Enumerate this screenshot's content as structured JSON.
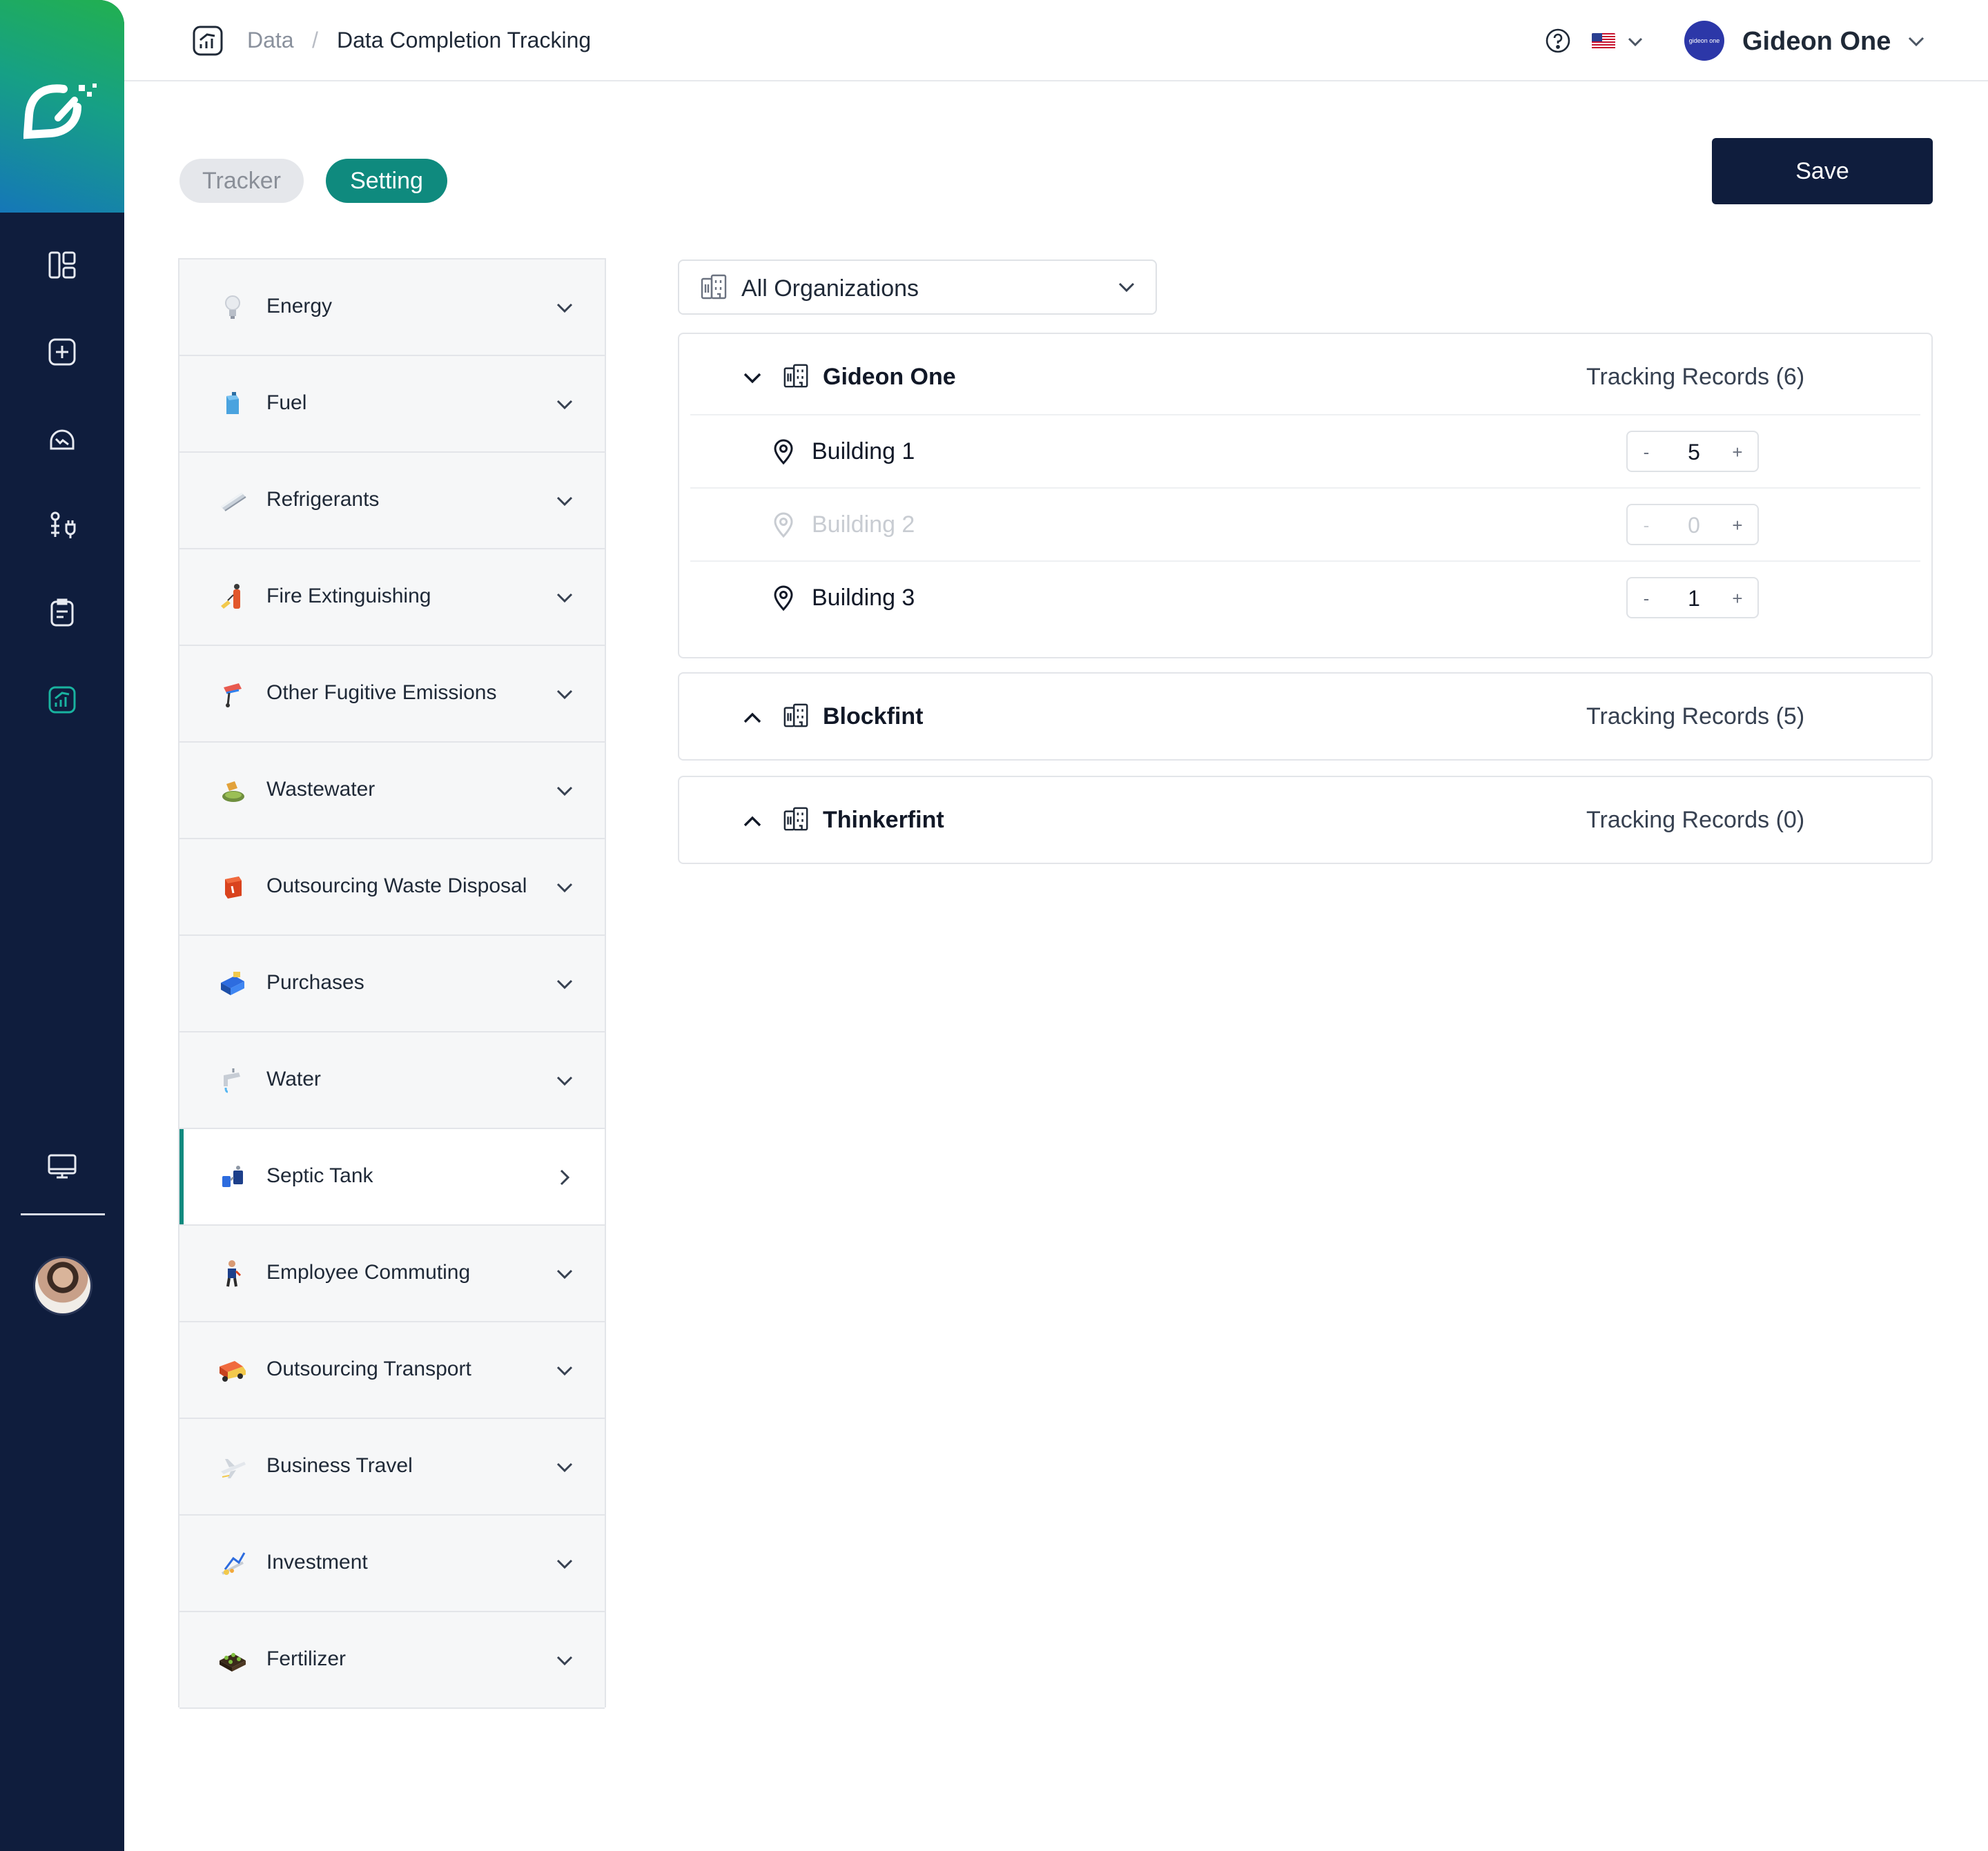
{
  "breadcrumb": {
    "root": "Data",
    "separator": "/",
    "current": "Data Completion Tracking"
  },
  "header": {
    "org_name": "Gideon One",
    "org_logo_text": "gideon one",
    "icons": {
      "help": "help-circle-icon",
      "language": "us-flag-icon"
    }
  },
  "tabs": [
    {
      "label": "Tracker",
      "active": false
    },
    {
      "label": "Setting",
      "active": true
    }
  ],
  "save_label": "Save",
  "categories": [
    {
      "label": "Energy",
      "icon": "lightbulb-icon"
    },
    {
      "label": "Fuel",
      "icon": "fuel-can-icon"
    },
    {
      "label": "Refrigerants",
      "icon": "refrigerant-pipe-icon"
    },
    {
      "label": "Fire Extinguishing",
      "icon": "fire-extinguisher-icon"
    },
    {
      "label": "Other Fugitive Emissions",
      "icon": "gas-valve-icon"
    },
    {
      "label": "Wastewater",
      "icon": "wastewater-icon"
    },
    {
      "label": "Outsourcing Waste Disposal",
      "icon": "waste-bin-icon"
    },
    {
      "label": "Purchases",
      "icon": "purchase-truck-icon"
    },
    {
      "label": "Water",
      "icon": "water-tap-icon"
    },
    {
      "label": "Septic Tank",
      "icon": "septic-tank-icon",
      "active": true
    },
    {
      "label": "Employee Commuting",
      "icon": "commuter-icon"
    },
    {
      "label": "Outsourcing Transport",
      "icon": "transport-truck-icon"
    },
    {
      "label": "Business Travel",
      "icon": "airplane-icon"
    },
    {
      "label": "Investment",
      "icon": "investment-chart-icon"
    },
    {
      "label": "Fertilizer",
      "icon": "fertilizer-icon"
    }
  ],
  "org_filter": {
    "label": "All Organizations"
  },
  "organizations": [
    {
      "name": "Gideon One",
      "records": "Tracking Records (6)",
      "expanded": true,
      "buildings": [
        {
          "name": "Building 1",
          "value": "5",
          "disabled": false
        },
        {
          "name": "Building 2",
          "value": "0",
          "disabled": true
        },
        {
          "name": "Building 3",
          "value": "1",
          "disabled": false
        }
      ]
    },
    {
      "name": "Blockfint",
      "records": "Tracking Records (5)",
      "expanded": false
    },
    {
      "name": "Thinkerfint",
      "records": "Tracking Records (0)",
      "expanded": false
    }
  ],
  "stepper": {
    "minus": "-",
    "plus": "+"
  },
  "colors": {
    "sidebar": "#0f1d3d",
    "accent": "#0f8a7e",
    "save": "#0f1d3d"
  }
}
